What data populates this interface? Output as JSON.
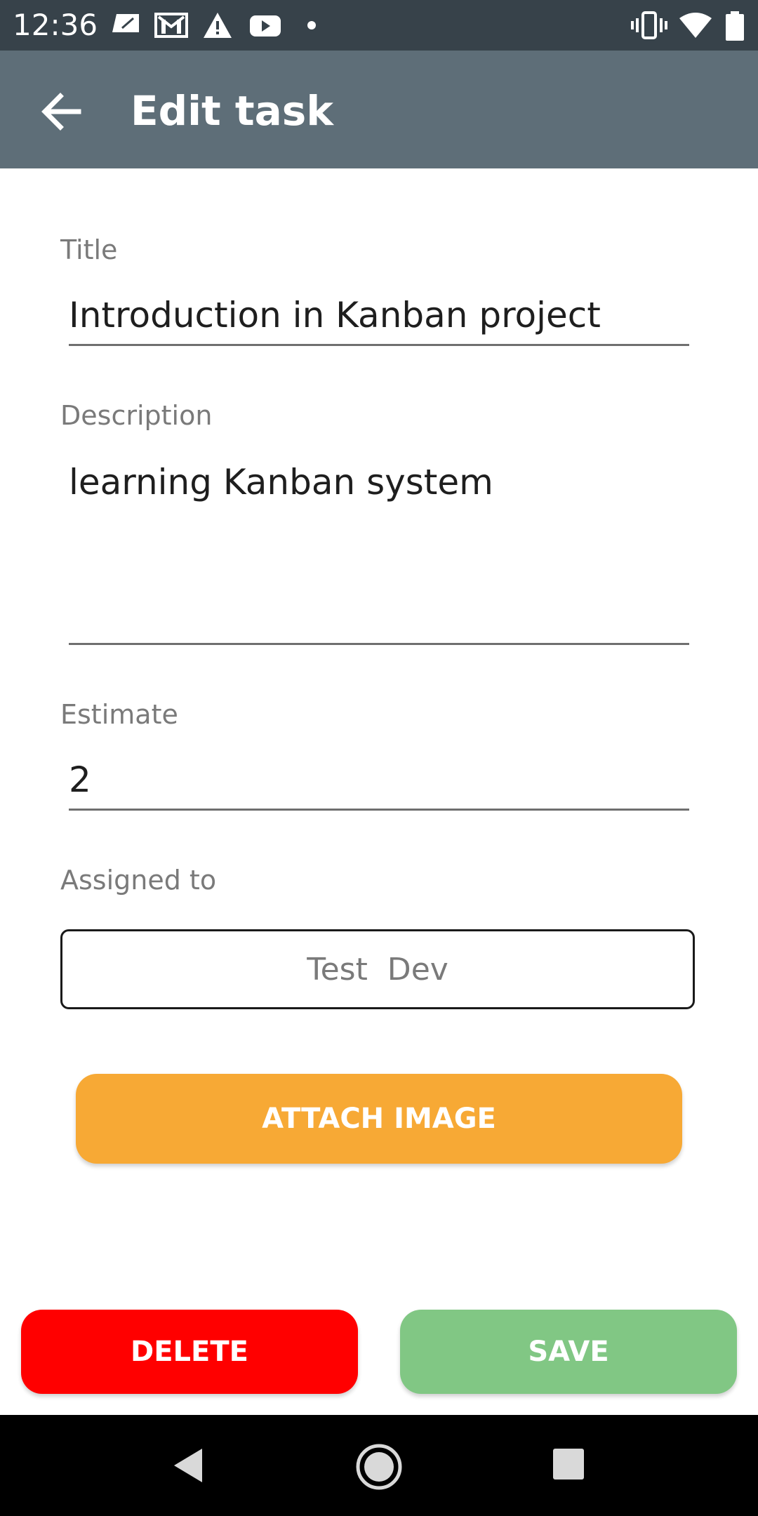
{
  "status_bar": {
    "time": "12:36",
    "left_icons": [
      "sim-card-icon",
      "gmail-icon",
      "warning-icon",
      "youtube-icon",
      "dot-icon"
    ],
    "right_icons": [
      "vibrate-icon",
      "wifi-icon",
      "battery-icon"
    ]
  },
  "app_bar": {
    "title": "Edit task",
    "back_icon": "arrow-back-icon",
    "color": "#5e6e78"
  },
  "form": {
    "title_label": "Title",
    "title_value": "Introduction in Kanban project",
    "description_label": "Description",
    "description_value": "learning Kanban system",
    "estimate_label": "Estimate",
    "estimate_value": "2",
    "assigned_label": "Assigned to",
    "assigned_value": "Test  Dev"
  },
  "buttons": {
    "attach": "ATTACH IMAGE",
    "delete": "DELETE",
    "save": "SAVE",
    "attach_color": "#f7a935",
    "delete_color": "#ff0000",
    "save_color": "#81c784"
  },
  "nav_bar": {
    "icons": [
      "back-triangle-icon",
      "home-circle-icon",
      "recents-square-icon"
    ]
  }
}
